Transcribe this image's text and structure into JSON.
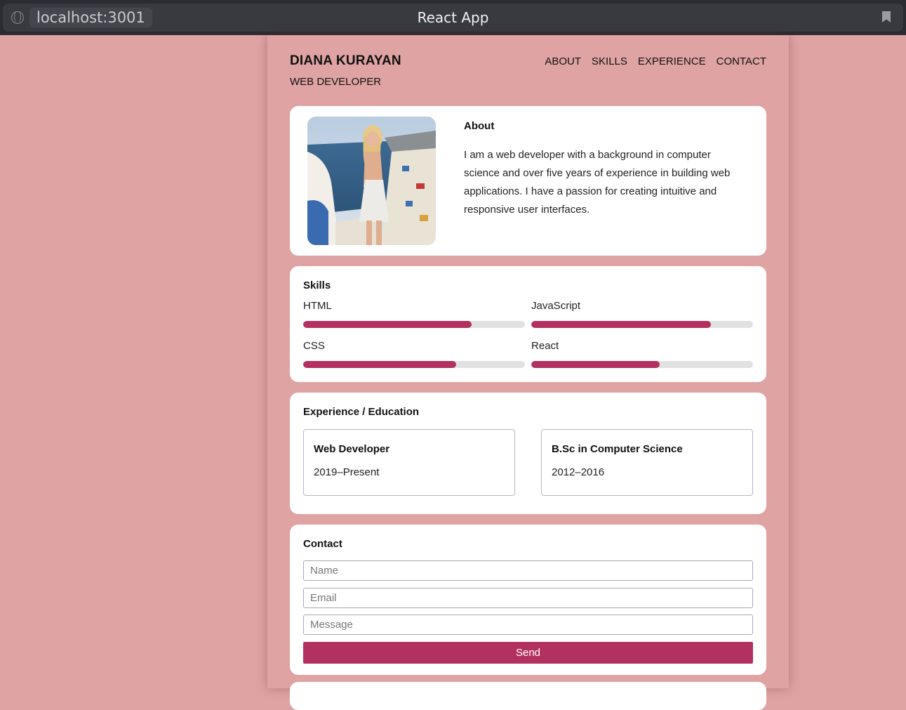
{
  "browser": {
    "url": "localhost:3001",
    "tab_title": "React App"
  },
  "header": {
    "name": "DIANA KURAYAN",
    "role": "WEB DEVELOPER",
    "nav": [
      "ABOUT",
      "SKILLS",
      "EXPERIENCE",
      "CONTACT"
    ]
  },
  "about": {
    "title": "About",
    "text": "I am a web developer with a background in computer science and over five years of experience in building web applications. I have a passion for creating intuitive and responsive user interfaces."
  },
  "skills": {
    "title": "Skills",
    "items": [
      {
        "label": "HTML",
        "level": 0.76
      },
      {
        "label": "JavaScript",
        "level": 0.81
      },
      {
        "label": "CSS",
        "level": 0.69
      },
      {
        "label": "React",
        "level": 0.58
      }
    ]
  },
  "experience": {
    "title": "Experience / Education",
    "items": [
      {
        "title": "Web Developer",
        "period": "2019–Present"
      },
      {
        "title": "B.Sc in Computer Science",
        "period": "2012–2016"
      }
    ]
  },
  "contact": {
    "title": "Contact",
    "name_placeholder": "Name",
    "email_placeholder": "Email",
    "message_placeholder": "Message",
    "send_label": "Send"
  },
  "colors": {
    "background": "#dfa3a3",
    "accent": "#b33160",
    "track": "#e1e1e1"
  }
}
